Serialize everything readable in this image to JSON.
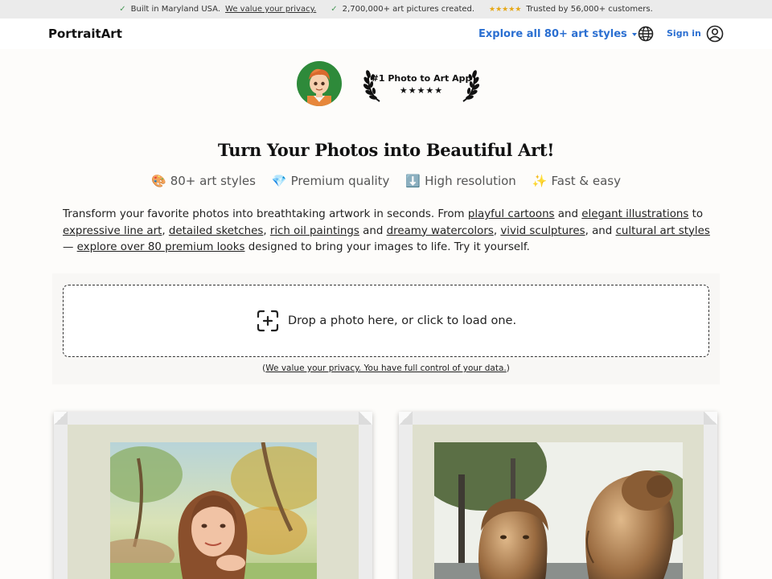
{
  "topbar": {
    "item1_text": "Built in Maryland USA.",
    "item1_link": "We value your privacy.",
    "item2_text": "2,700,000+ art pictures created.",
    "item3_stars": "★★★★★",
    "item3_text": "Trusted by 56,000+ customers."
  },
  "nav": {
    "brand": "PortraitArt",
    "explore_label": "Explore all 80+ art styles",
    "signin_label": "Sign in"
  },
  "award": {
    "text": "#1 Photo to Art App",
    "stars": "★★★★★"
  },
  "hero": {
    "title": "Turn Your Photos into Beautiful Art!"
  },
  "features": [
    {
      "emoji": "🎨",
      "label": "80+ art styles"
    },
    {
      "emoji": "💎",
      "label": "Premium quality"
    },
    {
      "emoji": "⬇️",
      "label": "High resolution"
    },
    {
      "emoji": "✨",
      "label": "Fast & easy"
    }
  ],
  "description": {
    "t1": "Transform your favorite photos into breathtaking artwork in seconds. From ",
    "l1": "playful cartoons",
    "t2": " and ",
    "l2": "elegant illustrations",
    "t3": " to ",
    "l3": "expressive line art",
    "t4": ", ",
    "l4": "detailed sketches",
    "t5": ", ",
    "l5": "rich oil paintings",
    "t6": " and ",
    "l6": "dreamy watercolors",
    "t7": ", ",
    "l7": "vivid sculptures",
    "t8": ", and ",
    "l8": "cultural art styles",
    "t9": " — ",
    "l9": "explore over 80 premium looks",
    "t10": " designed to bring your images to life. Try it yourself."
  },
  "upload": {
    "label": "Drop a photo here, or click to load one.",
    "privacy_open": "(",
    "privacy_link": "We value your privacy. You have full control of your data.",
    "privacy_close": ")"
  },
  "colors": {
    "accent": "#2b6fd1",
    "topbar_bg": "#ebebeb",
    "check": "#4a9a5a",
    "star": "#e6a817"
  },
  "icons": [
    "check-icon",
    "caret-down-icon",
    "globe-icon",
    "user-circle-icon",
    "laurel-icon",
    "add-photo-icon"
  ]
}
